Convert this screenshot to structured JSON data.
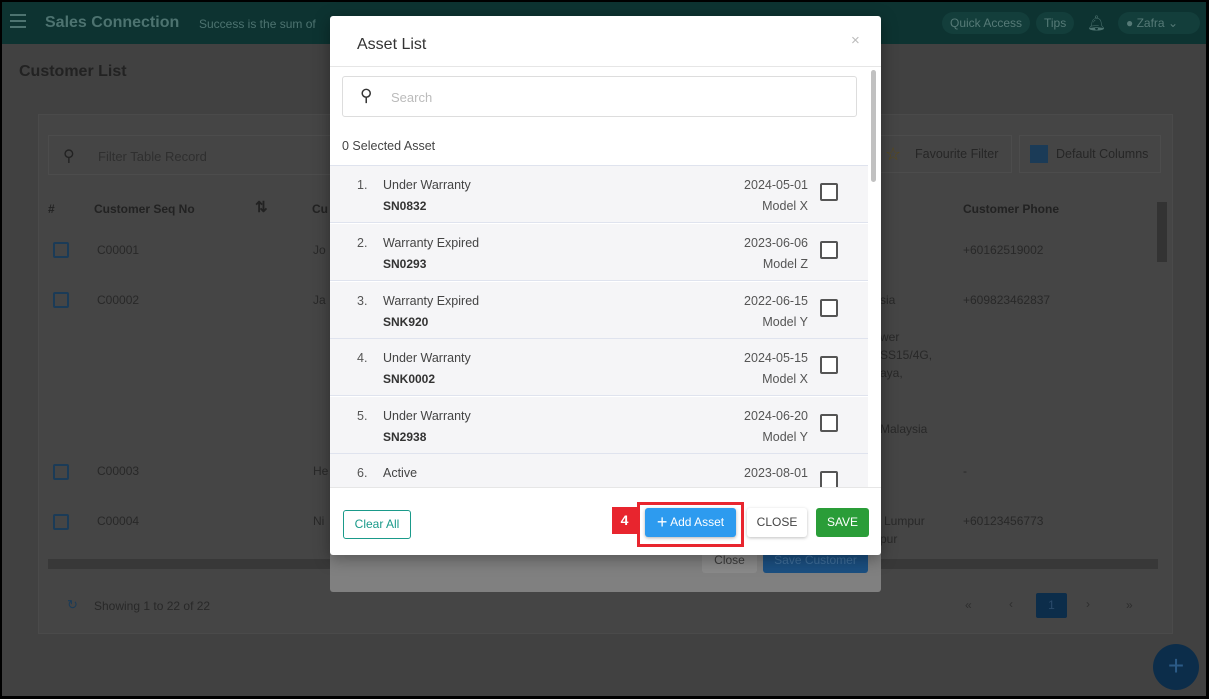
{
  "header": {
    "app_title": "Sales Connection",
    "tagline": "Success is the sum of",
    "quick_access": "Quick Access",
    "tips": "Tips",
    "user": "Zafra"
  },
  "page": {
    "title": "Customer List",
    "filter_placeholder": "Filter Table Record",
    "favourite_filter": "Favourite Filter",
    "default_columns": "Default Columns"
  },
  "table": {
    "headers": [
      "#",
      "Customer Seq No",
      "Cu",
      "Customer Phone"
    ],
    "rows": [
      {
        "seq": "C00001",
        "name": "Jo",
        "address": [
          ""
        ],
        "phone": "+60162519002"
      },
      {
        "seq": "C00002",
        "name": "Ja",
        "address": [
          "sia",
          "wer",
          "SS15/4G,",
          "aya,",
          "Malaysia"
        ],
        "phone": "+609823462837"
      },
      {
        "seq": "C00003",
        "name": "He",
        "address": [
          ""
        ],
        "phone": "-"
      },
      {
        "seq": "C00004",
        "name": "Ni",
        "address": [
          "Lumpur",
          "pur"
        ],
        "phone": "+60123456773"
      }
    ]
  },
  "footer": {
    "showing": "Showing 1 to 22 of 22",
    "current_page": "1",
    "first": "«",
    "prev": "‹",
    "next": "›",
    "last": "»"
  },
  "back_modal": {
    "close": "Close",
    "save_customer": "Save Customer"
  },
  "modal": {
    "title": "Asset List",
    "close_icon": "×",
    "search_placeholder": "Search",
    "selected": "0 Selected Asset",
    "items": [
      {
        "num": "1.",
        "status": "Under Warranty",
        "sn": "SN0832",
        "date": "2024-05-01",
        "model": "Model X"
      },
      {
        "num": "2.",
        "status": "Warranty Expired",
        "sn": "SN0293",
        "date": "2023-06-06",
        "model": "Model Z"
      },
      {
        "num": "3.",
        "status": "Warranty Expired",
        "sn": "SNK920",
        "date": "2022-06-15",
        "model": "Model Y"
      },
      {
        "num": "4.",
        "status": "Under Warranty",
        "sn": "SNK0002",
        "date": "2024-05-15",
        "model": "Model X"
      },
      {
        "num": "5.",
        "status": "Under Warranty",
        "sn": "SN2938",
        "date": "2024-06-20",
        "model": "Model Y"
      },
      {
        "num": "6.",
        "status": "Active",
        "sn": "",
        "date": "2023-08-01",
        "model": ""
      }
    ],
    "clear_all": "Clear All",
    "add_asset": "Add Asset",
    "close": "CLOSE",
    "save": "SAVE"
  },
  "annotation": {
    "step": "4",
    "color": "#e8252e"
  },
  "colors": {
    "header": "#0d3331",
    "primary": "#2d9bef",
    "save": "#2a9d38",
    "teal": "#1a9a8a"
  }
}
